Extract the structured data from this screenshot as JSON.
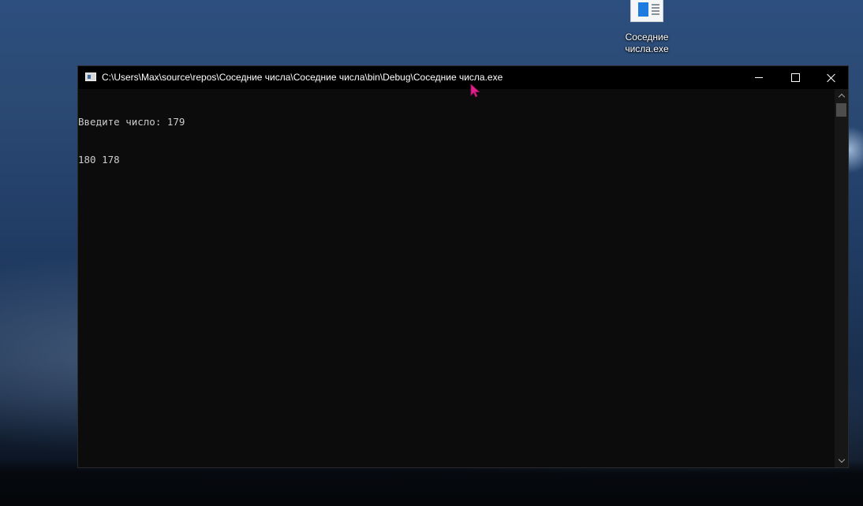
{
  "desktop": {
    "icon_label": "Соседние\nчисла.exe"
  },
  "window": {
    "title": "C:\\Users\\Max\\source\\repos\\Соседние числа\\Соседние числа\\bin\\Debug\\Соседние числа.exe",
    "console_lines": [
      "Введите число: 179",
      "180 178"
    ]
  },
  "icons": {
    "app": "console-app-icon",
    "minimize": "minimize-icon",
    "maximize": "maximize-icon",
    "close": "close-icon",
    "cursor": "mouse-pointer-icon"
  },
  "colors": {
    "console_bg": "#0c0c0c",
    "console_text": "#cccccc",
    "title_bar": "#000000",
    "cursor": "#e0208a"
  }
}
